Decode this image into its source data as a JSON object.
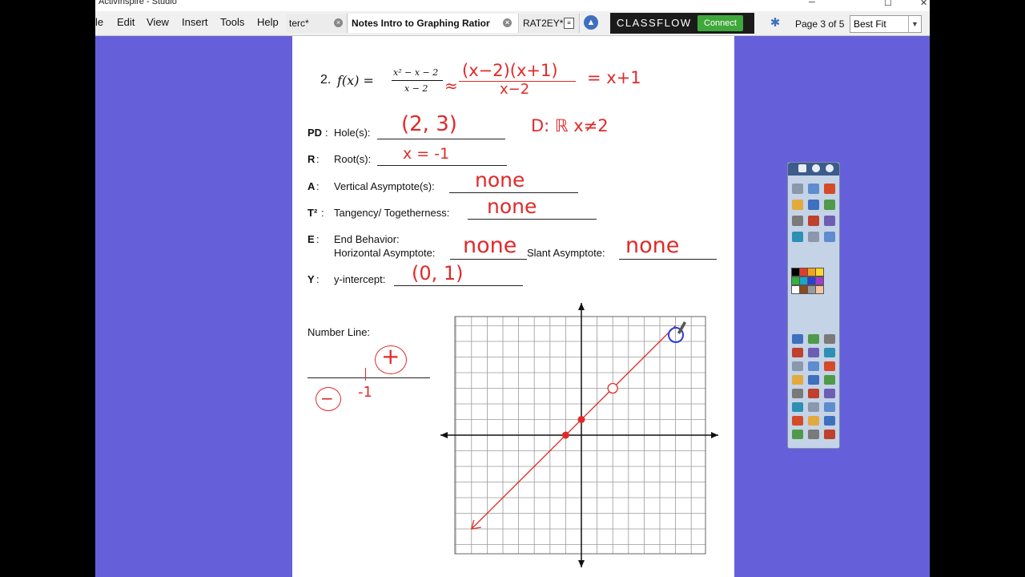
{
  "window": {
    "title": "ActivInspire - Studio",
    "controls": [
      "─",
      "☐",
      "✕"
    ]
  },
  "menu": {
    "items": [
      "le",
      "Edit",
      "View",
      "Insert",
      "Tools",
      "Help"
    ]
  },
  "tabs": [
    {
      "label": "terc*",
      "active": false
    },
    {
      "label": "Notes Intro to Graphing Ratior",
      "active": true
    },
    {
      "label": "RAT2EY*",
      "active": false
    }
  ],
  "classflow": {
    "brand": "CLASSFLOW",
    "connect_label": "Connect"
  },
  "page_indicator": "Page 3 of 5",
  "zoom": {
    "value": "Best Fit"
  },
  "worksheet": {
    "problem_number": "2.",
    "function_label": "f(x) =",
    "numerator": "x² − x − 2",
    "denominator": "x − 2",
    "rows": [
      {
        "key": "PD",
        "label": "Hole(s):",
        "answer": "(2, 3)"
      },
      {
        "key": "R",
        "label": "Root(s):",
        "answer": "x = -1"
      },
      {
        "key": "A",
        "label": "Vertical Asymptote(s):",
        "answer": "none"
      },
      {
        "key": "T²",
        "label": "Tangency/ Togetherness:",
        "answer": "none"
      }
    ],
    "end_behavior": {
      "key": "E",
      "title": "End Behavior:",
      "horizontal_label": "Horizontal Asymptote:",
      "horizontal_answer": "none",
      "slant_label": "Slant Asymptote:",
      "slant_answer": "none"
    },
    "y_intercept": {
      "key": "Y",
      "label": "y-intercept:",
      "answer": "(0, 1)"
    },
    "number_line": {
      "label": "Number Line:",
      "plus_sign": "+",
      "minus_sign": "−",
      "tick_value": "-1"
    },
    "handwriting": {
      "factored": "(x−2)(x+1)",
      "cancelled": "x−2",
      "simplified": "= x+1",
      "domain": "D: ℝ x≠2"
    }
  },
  "graph": {
    "x_range": [
      -8,
      8
    ],
    "y_range": [
      -8,
      8
    ],
    "grid": true,
    "line": {
      "from": [
        -7,
        -6
      ],
      "to": [
        6,
        7
      ]
    },
    "hole": [
      2,
      3
    ],
    "points": [
      [
        -1,
        0
      ],
      [
        0,
        1
      ]
    ],
    "line_color": "#e02a2a"
  },
  "colors": {
    "background": "#6560d9",
    "ink": "#e02a2a",
    "cursor": "#2a3de0"
  }
}
